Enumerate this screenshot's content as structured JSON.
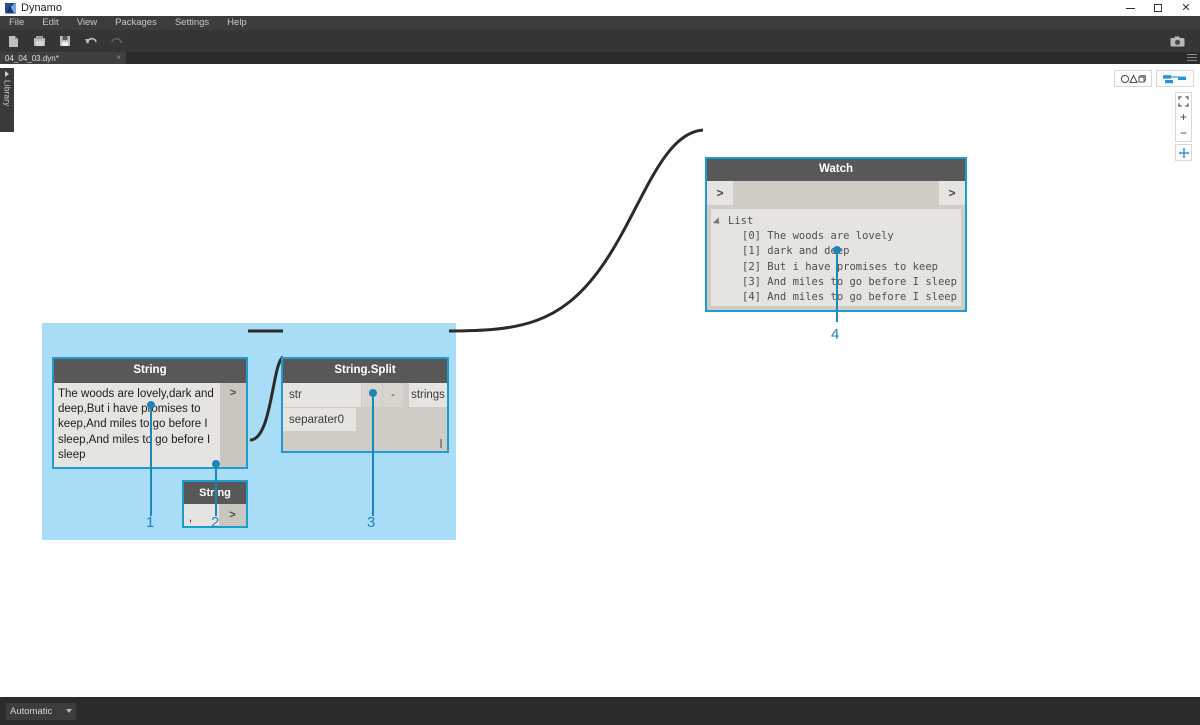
{
  "window": {
    "title": "Dynamo",
    "app_icon": "dynamo-logo-icon",
    "minimize_label": "minimize-icon",
    "maximize_label": "maximize-icon",
    "close_label": "×"
  },
  "menubar": {
    "items": [
      {
        "label": "File"
      },
      {
        "label": "Edit"
      },
      {
        "label": "View"
      },
      {
        "label": "Packages"
      },
      {
        "label": "Settings"
      },
      {
        "label": "Help"
      }
    ]
  },
  "toolbar": {
    "icons": [
      {
        "name": "new-file-icon"
      },
      {
        "name": "open-folder-icon"
      },
      {
        "name": "save-icon"
      },
      {
        "name": "undo-icon"
      },
      {
        "name": "redo-icon"
      }
    ],
    "camera_icon": "camera-icon"
  },
  "tabs": {
    "active": {
      "label": "04_04_03.dyn*",
      "close": "×"
    }
  },
  "library": {
    "label": "Library"
  },
  "nodes": {
    "string_input": {
      "title": "String",
      "value": "The woods are lovely,dark and deep,But i have promises to keep,And miles to go before I sleep,And miles to go before I sleep",
      "output_port": ">"
    },
    "string_separator": {
      "title": "String",
      "value": ",",
      "output_port": ">"
    },
    "string_split": {
      "title": "String.Split",
      "input_str": "str",
      "input_separator": "separater0",
      "add_button": "+",
      "remove_button": "-",
      "output": "strings"
    },
    "watch": {
      "title": "Watch",
      "input_port": ">",
      "output_port": ">",
      "list_label": "List",
      "list_items": [
        "[0] The woods are lovely",
        "[1] dark and deep",
        "[2] But i have promises to keep",
        "[3] And miles to go before I sleep",
        "[4] And miles to go before I sleep"
      ]
    }
  },
  "annotations": [
    {
      "number": "1"
    },
    {
      "number": "2"
    },
    {
      "number": "3"
    },
    {
      "number": "4"
    }
  ],
  "view_controls": {
    "geometry_view": "geometry-view-icon",
    "graph_view": "graph-view-icon",
    "zoom_to_fit": "zoom-to-fit-icon",
    "zoom_in": "+",
    "zoom_out": "−",
    "pan": "pan-icon"
  },
  "statusbar": {
    "run_mode": "Automatic"
  },
  "colors": {
    "accent_blue": "#1b86b8",
    "selection_blue": "#a9dcf7",
    "node_border": "#1f9bd0",
    "node_header": "#585858",
    "node_body": "#cfccc6"
  }
}
